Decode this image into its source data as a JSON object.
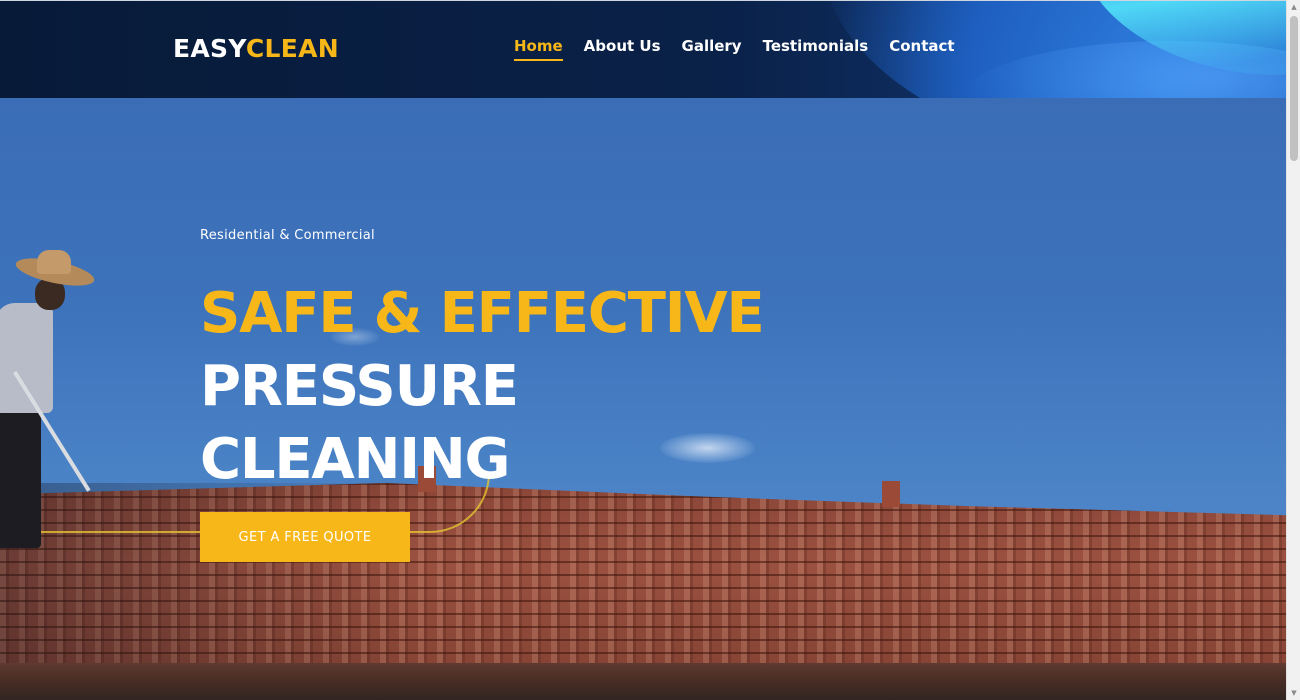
{
  "header": {
    "logo": {
      "part1": "EASY",
      "part2": "CLEAN"
    },
    "nav": [
      {
        "label": "Home",
        "active": true
      },
      {
        "label": "About Us",
        "active": false
      },
      {
        "label": "Gallery",
        "active": false
      },
      {
        "label": "Testimonials",
        "active": false
      },
      {
        "label": "Contact",
        "active": false
      }
    ]
  },
  "hero": {
    "tagline": "Residential & Commercial",
    "headline": {
      "line1": "SAFE & EFFECTIVE",
      "line2": "PRESSURE",
      "line3": "CLEANING"
    },
    "cta_label": "GET A FREE QUOTE",
    "background_image": "worker-pressure-cleaning-roof-tiles"
  },
  "colors": {
    "accent": "#f7b718",
    "header_bg": "#0a2148",
    "sky": "#3d73bb",
    "text_light": "#ffffff"
  },
  "scrollbar": {
    "up_icon": "▲",
    "down_icon": "▼"
  }
}
